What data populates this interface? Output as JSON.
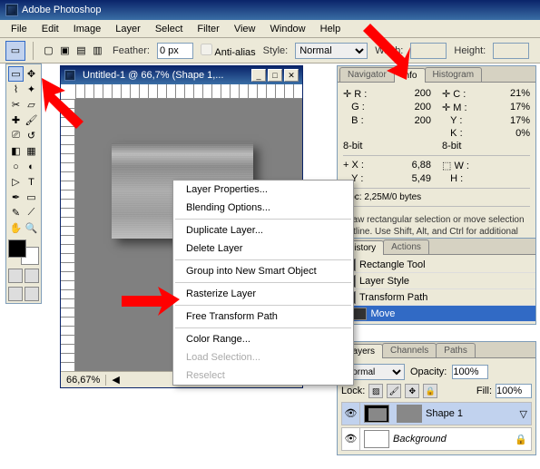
{
  "titlebar": {
    "text": "Adobe Photoshop"
  },
  "menu": {
    "file": "File",
    "edit": "Edit",
    "image": "Image",
    "layer": "Layer",
    "select": "Select",
    "filter": "Filter",
    "view": "View",
    "window": "Window",
    "help": "Help"
  },
  "opt": {
    "feather_lbl": "Feather:",
    "feather_val": "0 px",
    "anti": "Anti-alias",
    "style_lbl": "Style:",
    "style_val": "Normal",
    "width_lbl": "Width:",
    "height_lbl": "Height:"
  },
  "doc": {
    "title": "Untitled-1 @ 66,7% (Shape 1,...",
    "zoom": "66,67%"
  },
  "ctx": {
    "lp": "Layer Properties...",
    "bo": "Blending Options...",
    "dl": "Duplicate Layer...",
    "del": "Delete Layer",
    "gso": "Group into New Smart Object",
    "rl": "Rasterize Layer",
    "ftp": "Free Transform Path",
    "cr": "Color Range...",
    "ls": "Load Selection...",
    "rs": "Reselect"
  },
  "info": {
    "tabs": {
      "nav": "Navigator",
      "info": "Info",
      "hist": "Histogram"
    },
    "r_lbl": "R :",
    "r": "200",
    "g_lbl": "G :",
    "g": "200",
    "b_lbl": "B :",
    "b": "200",
    "c_lbl": "C :",
    "c": "21%",
    "m_lbl": "M :",
    "m": "17%",
    "y_lbl": "Y :",
    "y": "17%",
    "k_lbl": "K :",
    "k": "0%",
    "bit": "8-bit",
    "bit2": "8-bit",
    "x_lbl": "X :",
    "x": "6,88",
    "yy_lbl": "Y :",
    "yy": "5,49",
    "w_lbl": "W :",
    "h_lbl": "H :",
    "docsize": "Doc: 2,25M/0 bytes",
    "hint": "Draw rectangular selection or move selection outline. Use Shift, Alt, and Ctrl for additional options."
  },
  "history": {
    "tabs": {
      "h": "History",
      "a": "Actions"
    },
    "items": [
      "Rectangle Tool",
      "Layer Style",
      "Transform Path",
      "Move"
    ]
  },
  "layers": {
    "tabs": {
      "l": "Layers",
      "c": "Channels",
      "p": "Paths"
    },
    "mode": "Normal",
    "opacity_lbl": "Opacity:",
    "opacity": "100%",
    "lock_lbl": "Lock:",
    "fill_lbl": "Fill:",
    "fill": "100%",
    "shape": "Shape 1",
    "bg": "Background"
  }
}
